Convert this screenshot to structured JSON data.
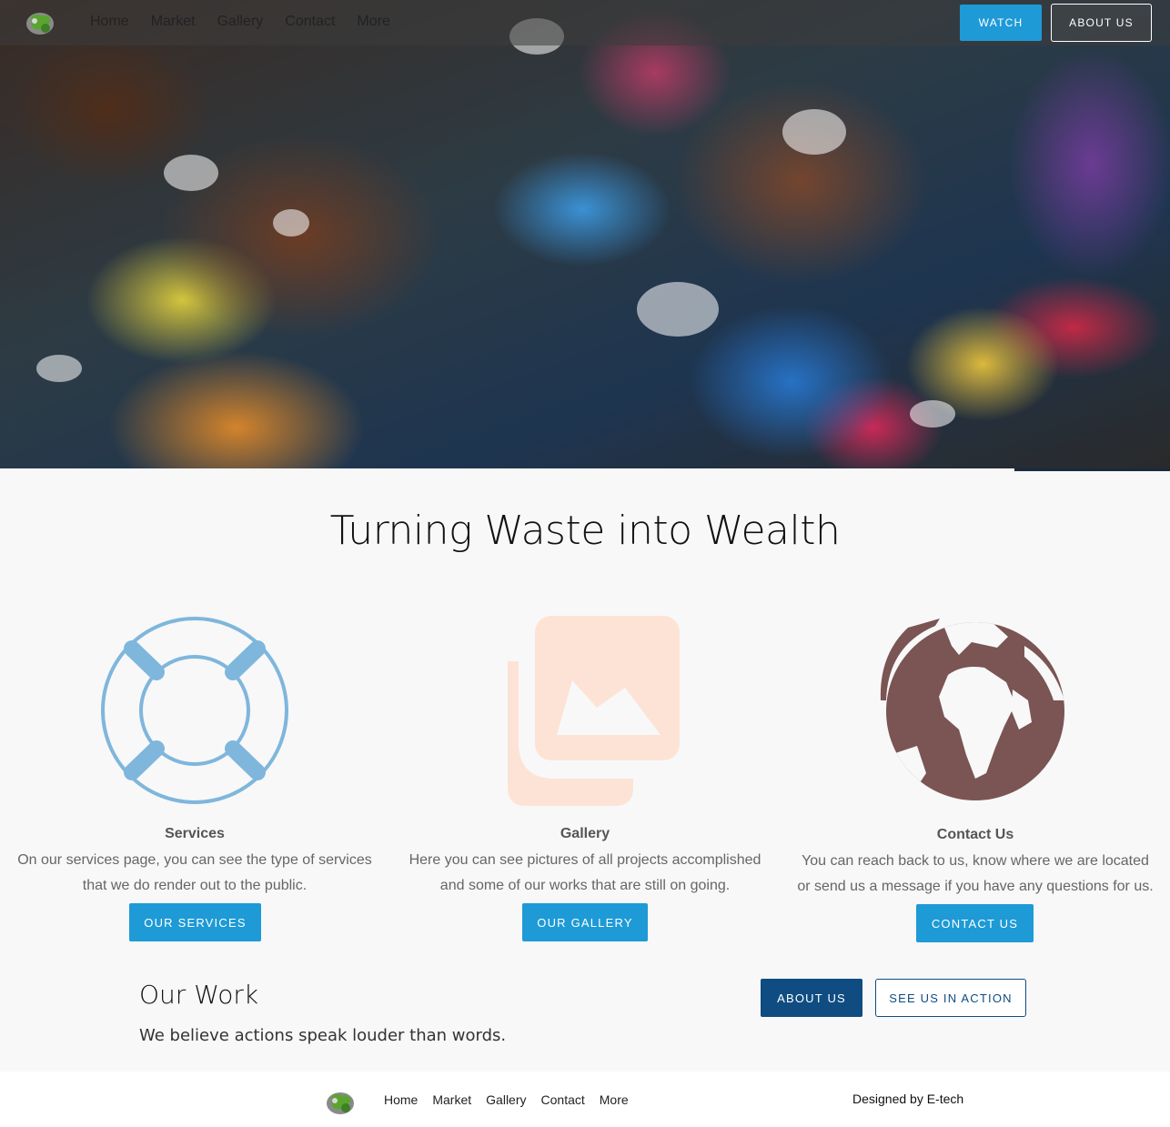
{
  "nav": {
    "links": [
      "Home",
      "Market",
      "Gallery",
      "Contact",
      "More"
    ],
    "watch_label": "WATCH",
    "about_label": "ABOUT US"
  },
  "headline": "Turning Waste into Wealth",
  "features": [
    {
      "icon": "lifebuoy-icon",
      "title": "Services",
      "description": "On our services page, you can see the type of services that we do render out to the public.",
      "button": "OUR SERVICES"
    },
    {
      "icon": "image-gallery-icon",
      "title": "Gallery",
      "description": "Here you can see pictures of all projects accomplished and some of our works that are still on going.",
      "button": "OUR GALLERY"
    },
    {
      "icon": "globe-icon",
      "title": "Contact Us",
      "description": "You can reach back to us, know where we are located or send us a message if you have any questions for us.",
      "button": "CONTACT US"
    }
  ],
  "work": {
    "title": "Our Work",
    "subtitle": "We believe actions speak louder than words.",
    "about_label": "ABOUT US",
    "action_label": "SEE US IN ACTION"
  },
  "footer": {
    "links": [
      "Home",
      "Market",
      "Gallery",
      "Contact",
      "More"
    ],
    "credit": "Designed by E-tech"
  },
  "colors": {
    "accent": "#1e9ad6",
    "dark_blue": "#0f4c81",
    "lifebuoy": "#7fb6dc",
    "gallery_icon": "#fde3d6",
    "globe": "#7b5454"
  }
}
